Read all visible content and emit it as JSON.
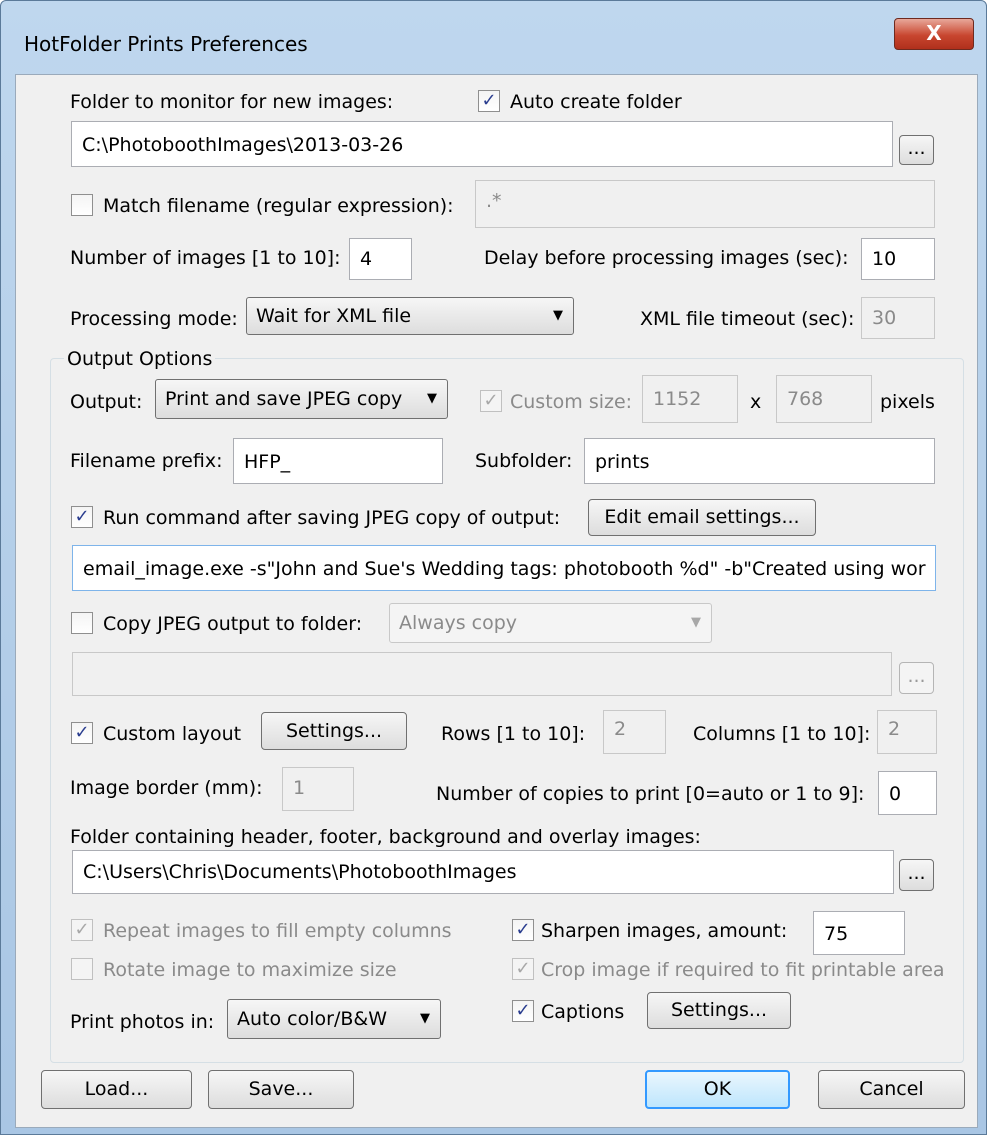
{
  "window": {
    "title": "HotFolder Prints Preferences",
    "close_glyph": "X"
  },
  "monitor": {
    "folder_label": "Folder to monitor for new images:",
    "auto_create_label": "Auto create folder",
    "auto_create_checked": true,
    "folder_value": "C:\\PhotoboothImages\\2013-03-26",
    "browse_label": "..."
  },
  "match": {
    "label": "Match filename (regular expression):",
    "checked": false,
    "value": ".*"
  },
  "images": {
    "count_label": "Number of images [1 to 10]:",
    "count_value": "4",
    "delay_label": "Delay before processing images (sec):",
    "delay_value": "10"
  },
  "processing": {
    "mode_label": "Processing mode:",
    "mode_value": "Wait for XML file",
    "timeout_label": "XML file timeout (sec):",
    "timeout_value": "30"
  },
  "output": {
    "group_label": "Output Options",
    "output_label": "Output:",
    "output_value": "Print and save JPEG copy",
    "custom_size_label": "Custom size:",
    "custom_size_checked": true,
    "width": "1152",
    "x_label": "x",
    "height": "768",
    "pixels_label": "pixels",
    "prefix_label": "Filename prefix:",
    "prefix_value": "HFP_",
    "subfolder_label": "Subfolder:",
    "subfolder_value": "prints",
    "run_cmd_label": "Run command after saving JPEG copy of output:",
    "run_cmd_checked": true,
    "email_button": "Edit email settings...",
    "command_value": "email_image.exe -s\"John and Sue's Wedding tags: photobooth %d\" -b\"Created using wor",
    "copy_label": "Copy JPEG output to folder:",
    "copy_checked": false,
    "copy_mode": "Always copy",
    "copy_folder_value": "",
    "copy_browse": "..."
  },
  "layout": {
    "custom_label": "Custom layout",
    "custom_checked": true,
    "settings_button": "Settings...",
    "rows_label": "Rows [1 to 10]:",
    "rows_value": "2",
    "cols_label": "Columns [1 to 10]:",
    "cols_value": "2",
    "border_label": "Image border (mm):",
    "border_value": "1",
    "copies_label": "Number of copies to print [0=auto or 1 to 9]:",
    "copies_value": "0",
    "overlay_label": "Folder containing header, footer, background and overlay images:",
    "overlay_value": "C:\\Users\\Chris\\Documents\\PhotoboothImages",
    "overlay_browse": "..."
  },
  "options": {
    "repeat_label": "Repeat images to fill empty columns",
    "repeat_checked": true,
    "sharpen_label": "Sharpen images, amount:",
    "sharpen_checked": true,
    "sharpen_value": "75",
    "rotate_label": "Rotate image to maximize size",
    "rotate_checked": false,
    "crop_label": "Crop image if required to fit printable area",
    "crop_checked": true,
    "print_in_label": "Print photos in:",
    "print_in_value": "Auto color/B&W",
    "captions_label": "Captions",
    "captions_checked": true,
    "captions_settings": "Settings..."
  },
  "buttons": {
    "load": "Load...",
    "save": "Save...",
    "ok": "OK",
    "cancel": "Cancel"
  }
}
